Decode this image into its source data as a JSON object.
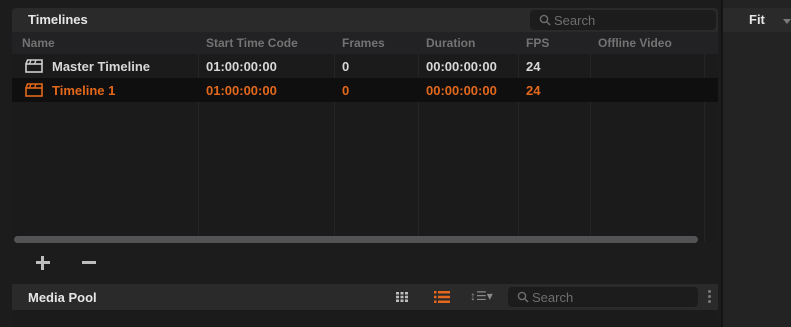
{
  "timelines": {
    "title": "Timelines",
    "search_placeholder": "Search",
    "columns": [
      "Name",
      "Start Time Code",
      "Frames",
      "Duration",
      "FPS",
      "Offline Video"
    ],
    "rows": [
      {
        "name": "Master Timeline",
        "start": "01:00:00:00",
        "frames": "0",
        "duration": "00:00:00:00",
        "fps": "24",
        "offline": "",
        "selected": false
      },
      {
        "name": "Timeline 1",
        "start": "01:00:00:00",
        "frames": "0",
        "duration": "00:00:00:00",
        "fps": "24",
        "offline": "",
        "selected": true
      }
    ]
  },
  "media_pool": {
    "title": "Media Pool",
    "search_placeholder": "Search"
  },
  "viewer": {
    "zoom_label": "Fit"
  },
  "colors": {
    "selected_text": "#e3681b",
    "list_icon_active": "#e3681b"
  },
  "icons": [
    "clapper-icon",
    "search-icon",
    "add-icon",
    "remove-icon",
    "grid-view-icon",
    "list-view-icon",
    "sort-icon",
    "more-options-icon",
    "dropdown-arrow-icon"
  ]
}
